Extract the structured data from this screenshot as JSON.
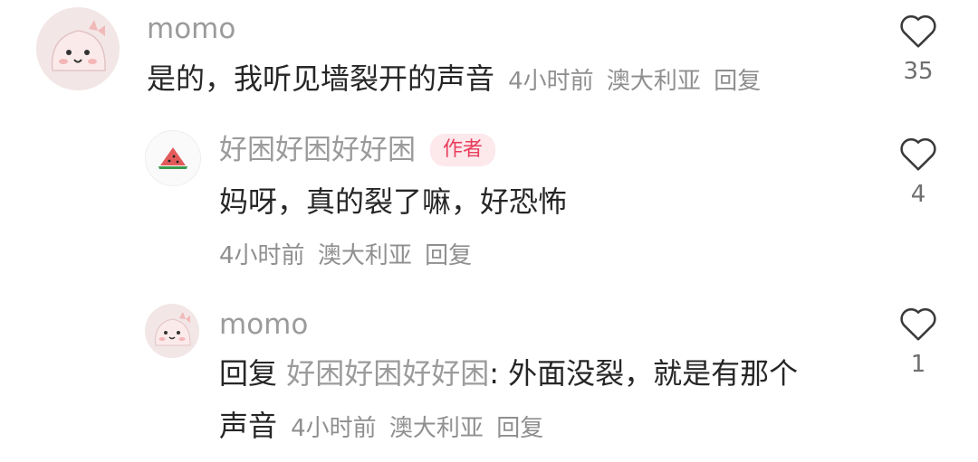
{
  "comments": [
    {
      "username": "momo",
      "text": "是的，我听见墙裂开的声音",
      "time": "4小时前",
      "location": "澳大利亚",
      "reply_label": "回复",
      "likes": "35"
    },
    {
      "username": "好困好困好好困",
      "badge": "作者",
      "text": "妈呀，真的裂了嘛，好恐怖",
      "time": "4小时前",
      "location": "澳大利亚",
      "reply_label": "回复",
      "likes": "4"
    },
    {
      "username": "momo",
      "reply_prefix": "回复",
      "reply_target": "好困好困好好困",
      "text_line1": ": 外面没裂，就是有那个",
      "text_line2": "声音",
      "time": "4小时前",
      "location": "澳大利亚",
      "reply_label": "回复",
      "likes": "1"
    }
  ],
  "colors": {
    "username": "#9b9b9b",
    "text": "#262626",
    "meta": "#8f8f8f",
    "badge_bg": "#fde8ec",
    "badge_text": "#e83e5c"
  }
}
